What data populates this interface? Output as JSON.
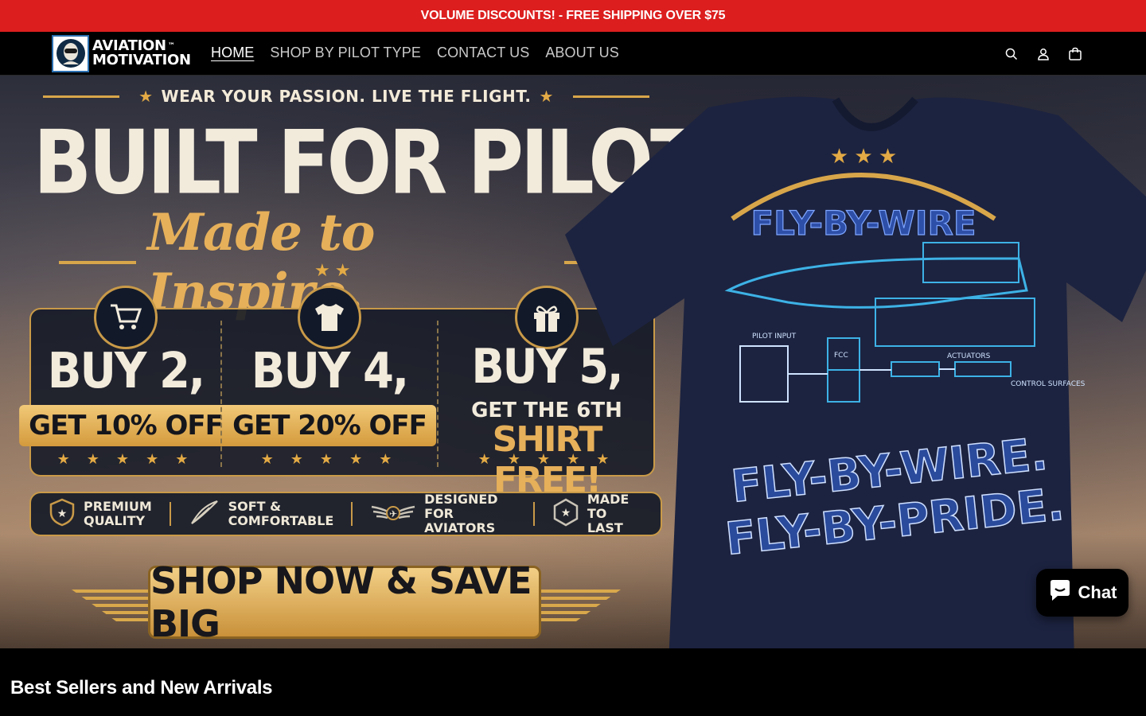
{
  "announcement": {
    "text": "VOLUME DISCOUNTS! - FREE SHIPPING OVER $75"
  },
  "header": {
    "logo": {
      "line1": "AVIATION",
      "line2": "MOTIVATION",
      "tm": "™"
    },
    "nav": [
      {
        "label": "HOME",
        "active": true
      },
      {
        "label": "SHOP BY PILOT TYPE",
        "active": false
      },
      {
        "label": "CONTACT US",
        "active": false
      },
      {
        "label": "ABOUT US",
        "active": false
      }
    ],
    "icons": [
      "search-icon",
      "account-icon",
      "cart-icon"
    ]
  },
  "hero": {
    "tagline": "WEAR YOUR PASSION. LIVE THE FLIGHT.",
    "headline": "BUILT FOR PILOTS.",
    "script": "Made to Inspire.",
    "offers": [
      {
        "buy": "BUY 2,",
        "deal": "GET 10% OFF",
        "icon": "cart-icon"
      },
      {
        "buy": "BUY 4,",
        "deal": "GET 20% OFF",
        "icon": "tshirt-icon"
      },
      {
        "buy": "BUY 5,",
        "small": "GET THE 6TH",
        "deal": "SHIRT FREE!",
        "icon": "gift-icon"
      }
    ],
    "features": [
      {
        "line1": "PREMIUM",
        "line2": "QUALITY",
        "icon": "star-shield-icon"
      },
      {
        "line1": "SOFT &",
        "line2": "COMFORTABLE",
        "icon": "feather-icon"
      },
      {
        "line1": "DESIGNED FOR",
        "line2": "AVIATORS",
        "icon": "wings-icon"
      },
      {
        "line1": "MADE TO",
        "line2": "LAST",
        "icon": "badge-icon"
      }
    ],
    "cta": "SHOP NOW & SAVE BIG",
    "shirt": {
      "arc_title": "FLY-BY-WIRE",
      "line1": "FLY-BY-WIRE.",
      "line2": "FLY-BY-PRIDE.",
      "labels": {
        "pilot_input": "PILOT INPUT",
        "actuators": "ACTUATORS",
        "control": "CONTROL SURFACES",
        "fcc": "FCC"
      }
    }
  },
  "chat": {
    "label": "Chat"
  },
  "section": {
    "title": "Best Sellers and New Arrivals"
  },
  "colors": {
    "announcement_bg": "#dc1e1e",
    "gold": "#d8a64a",
    "navy_shirt": "#1c2340"
  }
}
